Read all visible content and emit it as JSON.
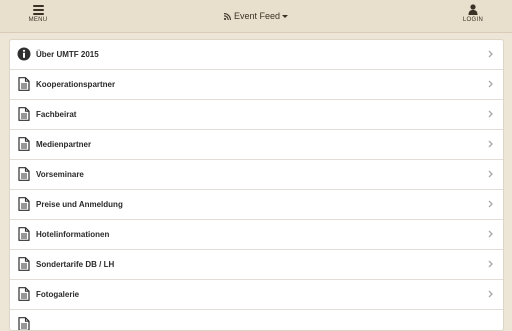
{
  "topbar": {
    "menu_label": "MENU",
    "feed_label": "Event Feed",
    "login_label": "LOGIN"
  },
  "list": {
    "items": [
      {
        "label": "Über UMTF 2015",
        "icon": "info-icon"
      },
      {
        "label": "Kooperationspartner",
        "icon": "document-icon"
      },
      {
        "label": "Fachbeirat",
        "icon": "document-icon"
      },
      {
        "label": "Medienpartner",
        "icon": "document-icon"
      },
      {
        "label": "Vorseminare",
        "icon": "document-icon"
      },
      {
        "label": "Preise und Anmeldung",
        "icon": "document-icon"
      },
      {
        "label": "Hotelinformationen",
        "icon": "document-icon"
      },
      {
        "label": "Sondertarife DB / LH",
        "icon": "document-icon"
      },
      {
        "label": "Fotogalerie",
        "icon": "document-icon"
      },
      {
        "label": "",
        "icon": "document-icon"
      }
    ]
  },
  "colors": {
    "background": "#ede5d6",
    "topbar": "#e9dfcd",
    "text": "#2a2a2a",
    "chevron": "#a8a8a8"
  }
}
